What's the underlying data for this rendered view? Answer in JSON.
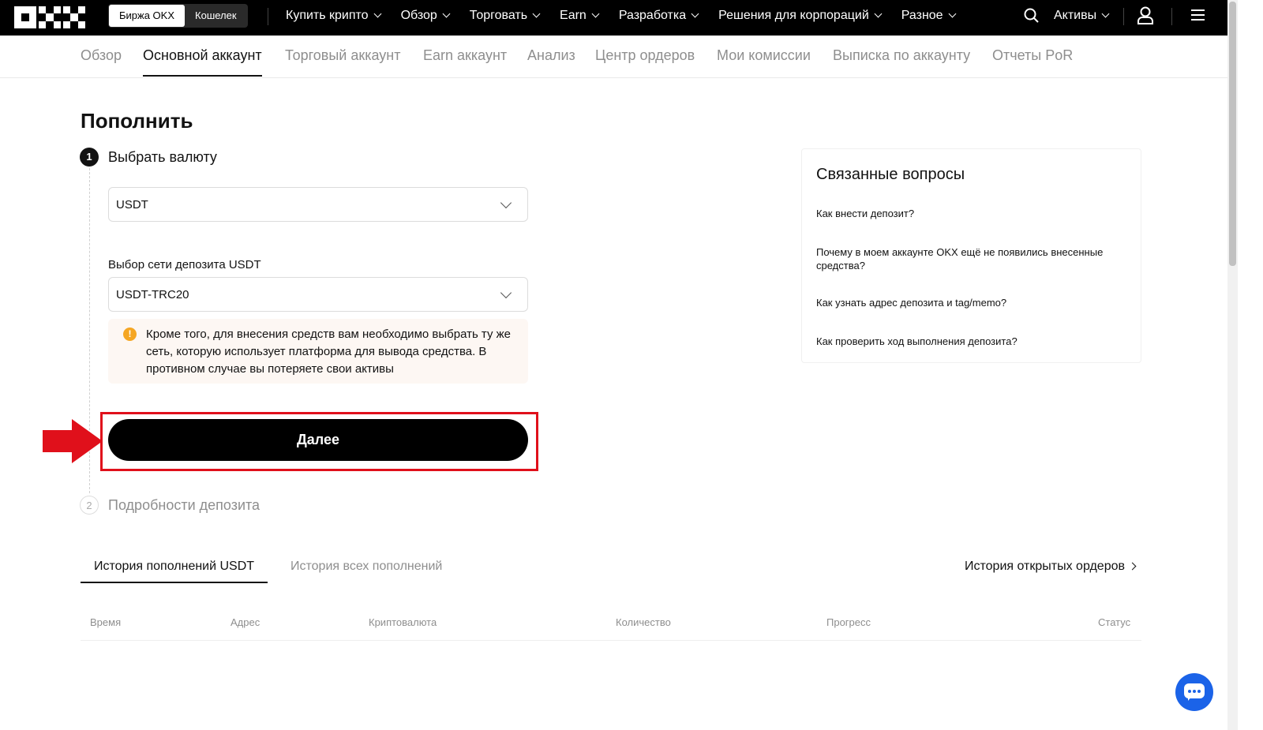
{
  "topnav": {
    "segments": [
      "Биржа OKX",
      "Кошелек"
    ],
    "links": [
      "Купить крипто",
      "Обзор",
      "Торговать",
      "Earn",
      "Разработка",
      "Решения для корпораций",
      "Разное"
    ],
    "assets_label": "Активы",
    "icons": [
      "search-icon",
      "user-icon",
      "menu-icon"
    ]
  },
  "subnav": {
    "tabs": [
      "Обзор",
      "Основной аккаунт",
      "Торговый аккаунт",
      "Earn аккаунт",
      "Анализ",
      "Центр ордеров",
      "Мои комиссии",
      "Выписка по аккаунту",
      "Отчеты PoR"
    ],
    "active": "Основной аккаунт"
  },
  "deposit": {
    "title": "Пополнить",
    "step1": {
      "number": "1",
      "label": "Выбрать валюту"
    },
    "currency_value": "USDT",
    "network_label": "Выбор сети депозита USDT",
    "network_value": "USDT-TRC20",
    "warning_icon": "!",
    "warning_text": "Кроме того, для внесения средств вам необходимо выбрать ту же сеть, которую использует платформа для вывода средства. В противном случае вы потеряете свои активы",
    "next_button": "Далее",
    "step2": {
      "number": "2",
      "label": "Подробности депозита"
    }
  },
  "faq": {
    "title": "Связанные вопросы",
    "questions": [
      "Как внести депозит?",
      "Почему в моем аккаунте OKX ещё не появились внесенные средства?",
      "Как узнать адрес депозита и tag/memo?",
      "Как проверить ход выполнения депозита?"
    ]
  },
  "history": {
    "tabs": [
      "История пополнений USDT",
      "История всех пополнений"
    ],
    "open_orders_link": "История открытых ордеров",
    "columns": [
      "Время",
      "Адрес",
      "Криптовалюта",
      "Количество",
      "Прогресс",
      "Статус"
    ]
  },
  "colors": {
    "highlight": "#e0101b",
    "chat": "#1b63e8",
    "warning": "#f5a623"
  }
}
